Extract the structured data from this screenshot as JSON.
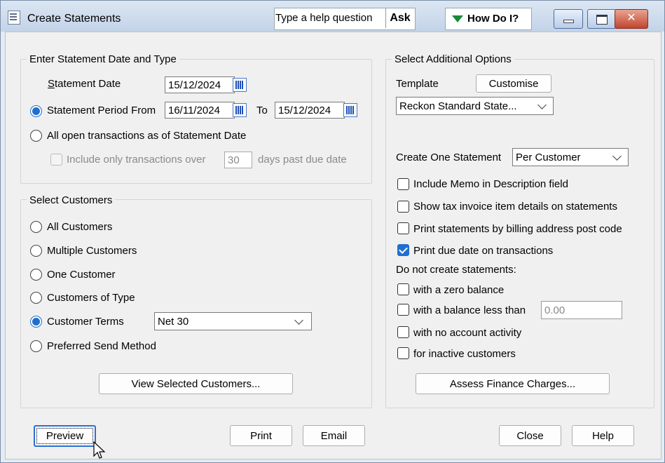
{
  "window": {
    "title": "Create Statements",
    "help_question": "Type a help question",
    "ask": "Ask",
    "how_do_i": "How Do I?"
  },
  "statement_date_group": {
    "legend": "Enter Statement Date and Type",
    "statement_date_label": "Statement Date",
    "statement_date_value": "15/12/2024",
    "period_from_label": "Statement Period From",
    "period_from_value": "16/11/2024",
    "to_label": "To",
    "period_to_value": "15/12/2024",
    "all_open_label": "All open transactions as of Statement Date",
    "include_only_label": "Include only transactions over",
    "days_value": "30",
    "days_past_label": "days past due date",
    "selected": "period"
  },
  "customers_group": {
    "legend": "Select Customers",
    "options": [
      "All Customers",
      "Multiple Customers",
      "One Customer",
      "Customers of Type",
      "Customer Terms",
      "Preferred Send Method"
    ],
    "selected": "Customer Terms",
    "terms_value": "Net 30",
    "view_selected_button": "View Selected Customers..."
  },
  "options_group": {
    "legend": "Select Additional Options",
    "template_label": "Template",
    "customise_button": "Customise",
    "template_value": "Reckon Standard State...",
    "create_one_label": "Create One Statement",
    "create_one_value": "Per Customer",
    "checkboxes": [
      {
        "label": "Include Memo in Description field",
        "checked": false
      },
      {
        "label": "Show tax invoice item details on statements",
        "checked": false
      },
      {
        "label": "Print statements by billing address post code",
        "checked": false
      },
      {
        "label": "Print due date on transactions",
        "checked": true
      }
    ],
    "do_not_create_label": "Do not create statements:",
    "do_not_create": [
      {
        "label": "with a zero balance",
        "checked": false
      },
      {
        "label": "with a balance less than",
        "checked": false
      },
      {
        "label": "with no account activity",
        "checked": false
      },
      {
        "label": "for inactive customers",
        "checked": false
      }
    ],
    "balance_less_than_value": "0.00",
    "assess_finance_button": "Assess Finance Charges..."
  },
  "footer": {
    "preview": "Preview",
    "print": "Print",
    "email": "Email",
    "close": "Close",
    "help": "Help"
  },
  "colors": {
    "accent": "#1f6fd0",
    "window_bg": "#f0f0f0",
    "title_bg": "#c3d3e8"
  }
}
